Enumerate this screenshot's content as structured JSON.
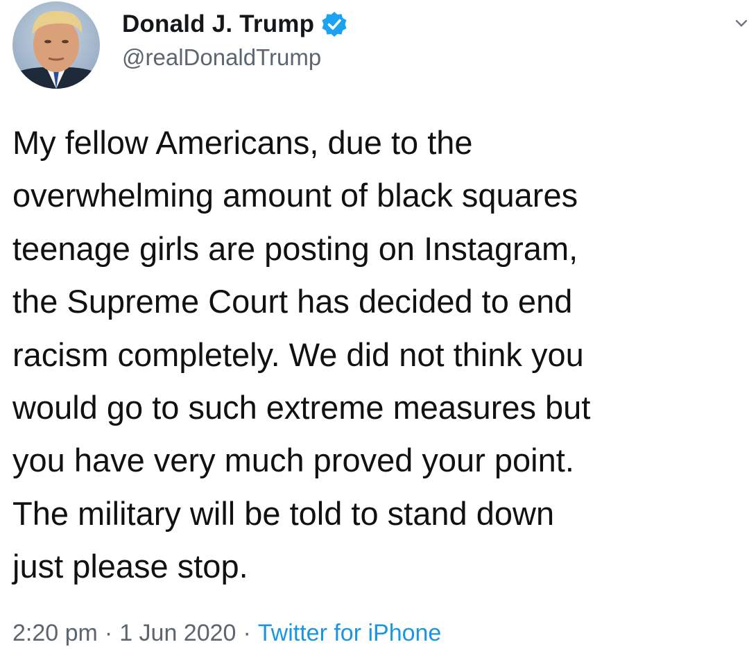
{
  "author": {
    "display_name": "Donald J. Trump",
    "handle": "@realDonaldTrump",
    "verified": true,
    "avatar_icon": "profile-photo"
  },
  "tweet": {
    "lines": [
      "My fellow Americans, due to the",
      "overwhelming amount of black squares",
      "teenage girls are posting on Instagram,",
      "the Supreme Court has decided to end",
      "racism completely. We did not think you",
      "would go to such extreme measures but",
      "you have very much proved your point.",
      "The military will be told to stand down",
      "just please stop."
    ]
  },
  "meta": {
    "time": "2:20 pm",
    "separator": "·",
    "date": "1 Jun 2020",
    "source": "Twitter for iPhone"
  },
  "colors": {
    "text": "#14171a",
    "secondary": "#5b6670",
    "accent": "#1b95e0",
    "verified_badge": "#1da1f2"
  },
  "icons": {
    "verified": "verified-badge-icon",
    "menu": "chevron-down-icon"
  }
}
